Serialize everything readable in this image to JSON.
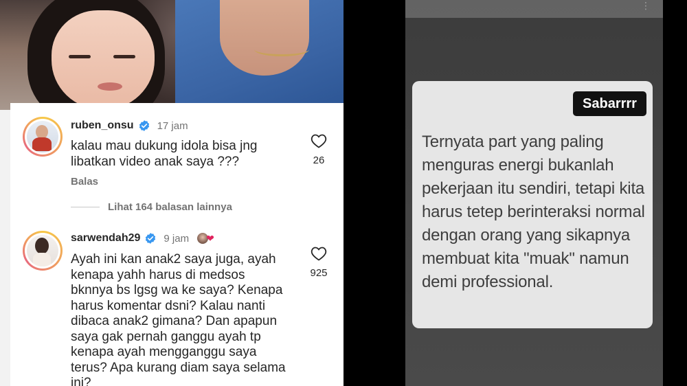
{
  "comments": [
    {
      "username": "ruben_onsu",
      "time": "17 jam",
      "text": "kalau mau dukung idola bisa jng\nlibatkan video anak saya ???",
      "likes": "26",
      "reply_label": "Balas"
    },
    {
      "username": "sarwendah29",
      "time": "9 jam",
      "text": "Ayah ini kan anak2 saya juga, ayah\nkenapa yahh harus di medsos\nbknnya bs lgsg wa ke saya? Kenapa\nharus komentar dsni? Kalau nanti\ndibaca anak2 gimana? Dan apapun\nsaya gak pernah ganggu ayah tp\nkenapa ayah mengganggu saya\nterus? Apa kurang diam saya selama\nini?",
      "likes": "925"
    }
  ],
  "more_replies": "Lihat 164 balasan lainnya",
  "story": {
    "sticker": "Sabarrrr",
    "quote": "Ternyata part yang paling\nmenguras energi bukanlah\npekerjaan itu sendiri, tetapi kita\nharus tetep berinteraksi normal\ndengan orang yang sikapnya\nmembuat kita \"muak\" namun\ndemi professional."
  },
  "colors": {
    "verified": "#3897f0",
    "text": "#262626",
    "muted": "#737373"
  },
  "icons": {
    "verified": "verified-badge-icon",
    "like": "heart-outline-icon",
    "menu": "more-dots-icon"
  }
}
